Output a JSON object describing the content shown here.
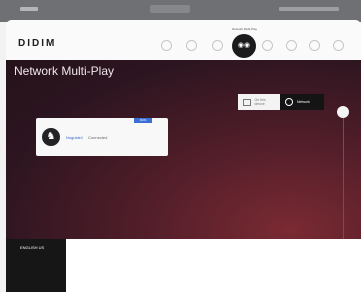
{
  "app": {
    "logo": "DIDIM"
  },
  "hub": {
    "label": "Network Multi-Play",
    "glyph": "◉◉"
  },
  "page": {
    "title": "Network Multi-Play"
  },
  "mode_toggle": {
    "local_label": "On this device",
    "network_label": "Network"
  },
  "device": {
    "badge": "RUN",
    "name": "Noguide1",
    "status": "Connected",
    "icon_glyph": "♞"
  },
  "footer": {
    "language": "ENGLISH US",
    "right_text": ""
  },
  "header_icons": [
    "home-icon",
    "plus-icon",
    "stamp-icon",
    "clipboard-icon",
    "gear-icon",
    "chat-icon",
    "power-icon"
  ],
  "colors": {
    "bg_dark": "#2c1520",
    "accent_red": "#7a2a33",
    "badge_blue": "#3c6fd6"
  }
}
